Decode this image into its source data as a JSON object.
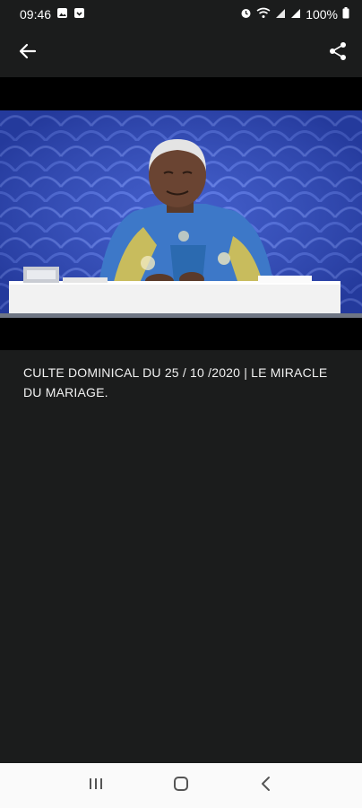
{
  "status_bar": {
    "time": "09:46",
    "battery": "100%",
    "icons": [
      "gallery-icon",
      "download-icon",
      "alarm-icon",
      "wifi-icon",
      "signal-icon",
      "signal-icon",
      "battery-icon"
    ]
  },
  "app_bar": {
    "back_icon": "arrow-left-icon",
    "share_icon": "share-icon"
  },
  "video": {
    "description": "Video frame"
  },
  "caption": {
    "title": "CULTE DOMINICAL DU 25 / 10 /2020 | LE MIRACLE DU MARIAGE."
  },
  "nav_bar": {
    "icons": [
      "recent-apps-icon",
      "home-icon",
      "back-icon"
    ]
  },
  "colors": {
    "background": "#1b1c1c",
    "video_bg": "#000000",
    "nav_bg": "#fafafa",
    "backdrop_blue": "#2f4ab8"
  }
}
